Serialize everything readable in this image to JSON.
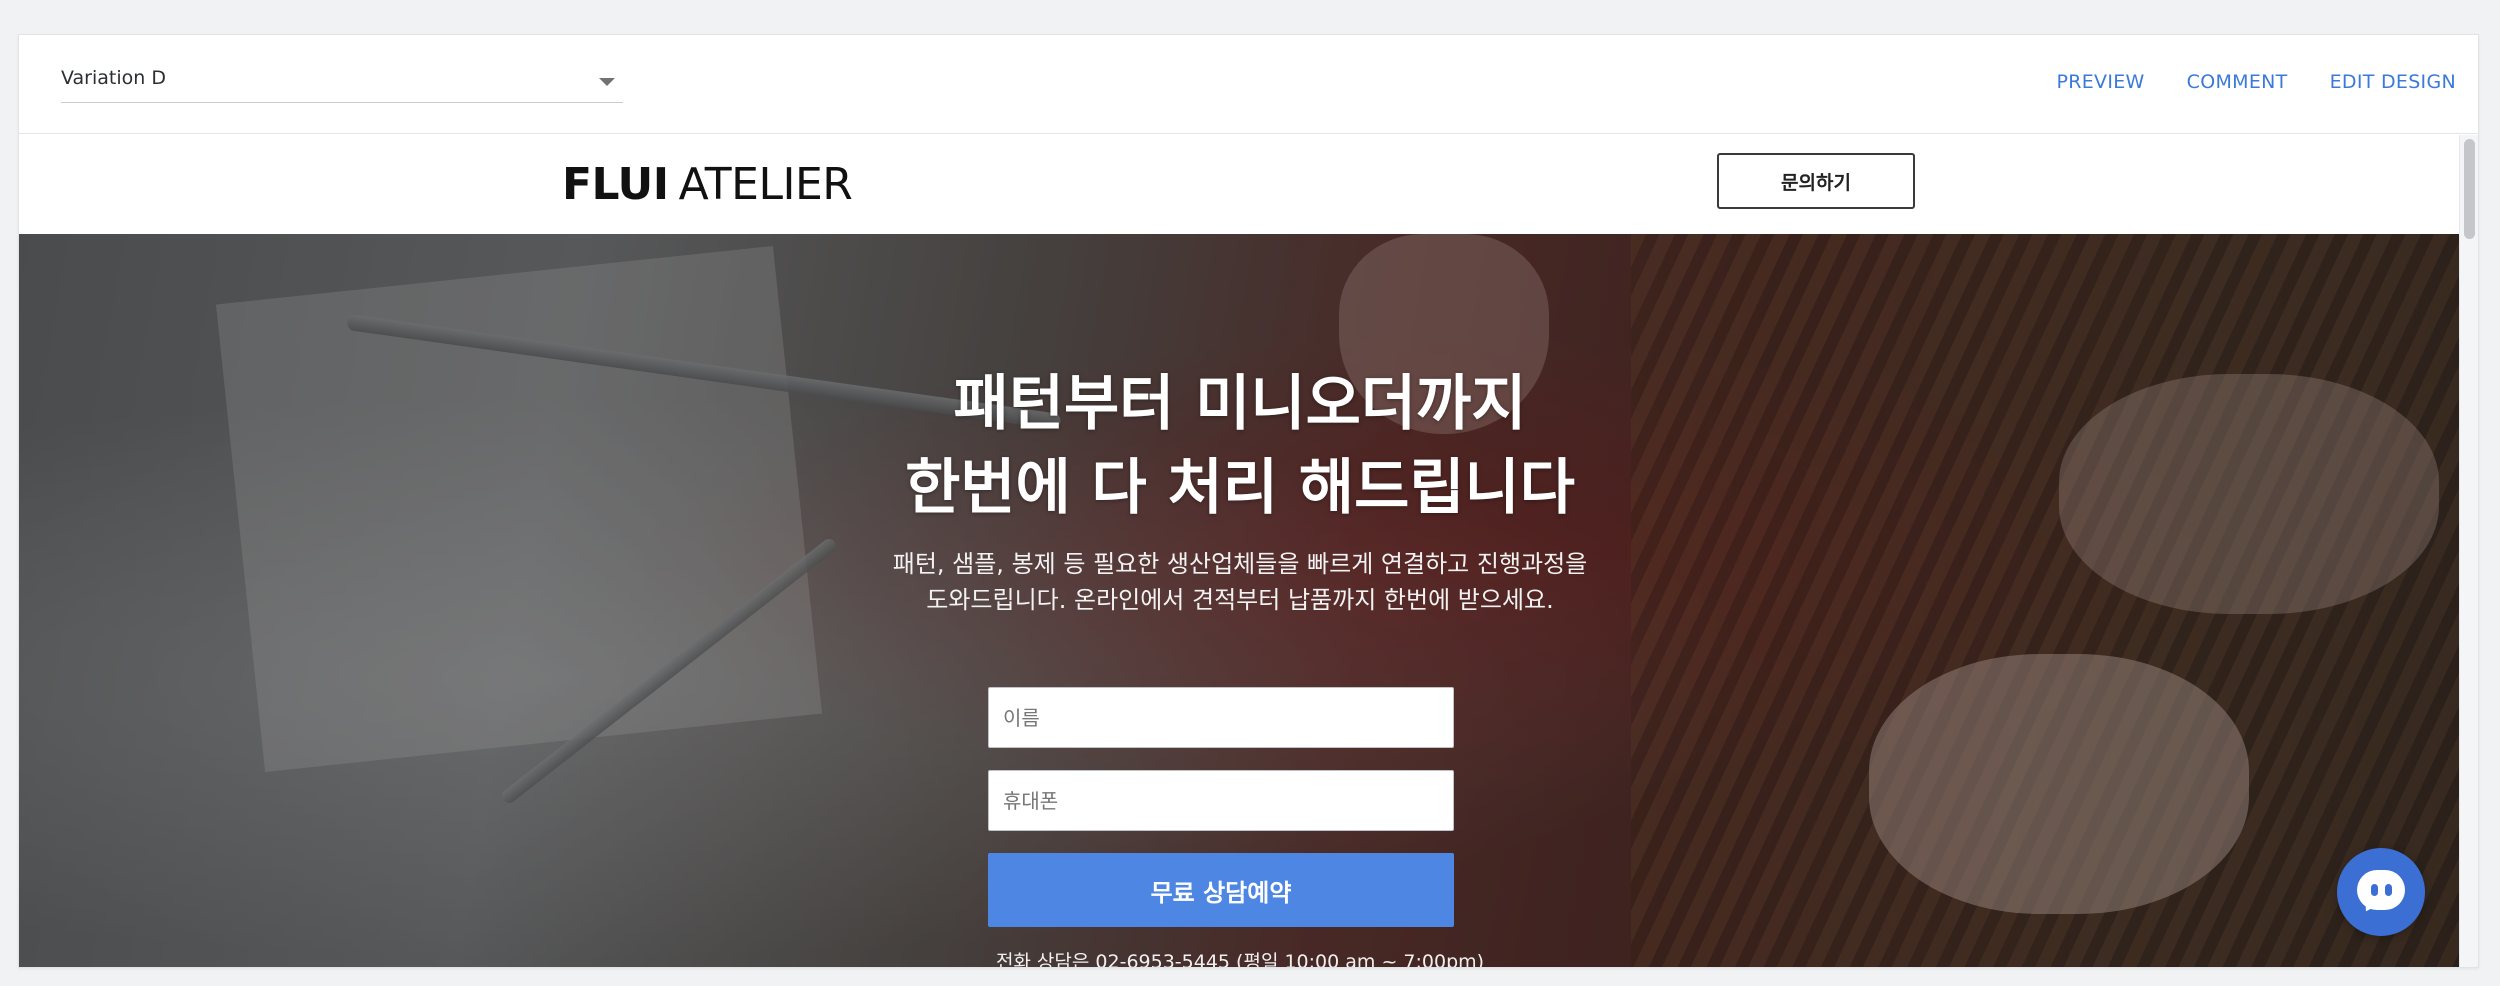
{
  "editor": {
    "variation_selected": "Variation D",
    "actions": [
      "PREVIEW",
      "COMMENT",
      "EDIT DESIGN"
    ]
  },
  "site": {
    "logo_bold": "FLUI",
    "logo_light": "ATELIER",
    "inquiry_button": "문의하기"
  },
  "hero": {
    "headline_line1": "패턴부터 미니오더까지",
    "headline_line2": "한번에 다 처리 해드립니다",
    "sub_line1": "패턴, 샘플, 봉제 등 필요한 생산업체들을 빠르게 연결하고 진행과정을",
    "sub_line2": "도와드립니다. 온라인에서 견적부터 납품까지 한번에 받으세요.",
    "name_placeholder": "이름",
    "phone_placeholder": "휴대폰",
    "submit_label": "무료 상담예약",
    "phone_note": "전화 상담은 02-6953-5445 (평일 10:00 am ~ 7:00pm)"
  },
  "colors": {
    "accent": "#4e86e4",
    "link": "#3b7ad8",
    "chat": "#3c6fd3"
  },
  "icons": {
    "variation_caret": "chevron-down-icon",
    "chat": "chat-bubble-icon"
  }
}
